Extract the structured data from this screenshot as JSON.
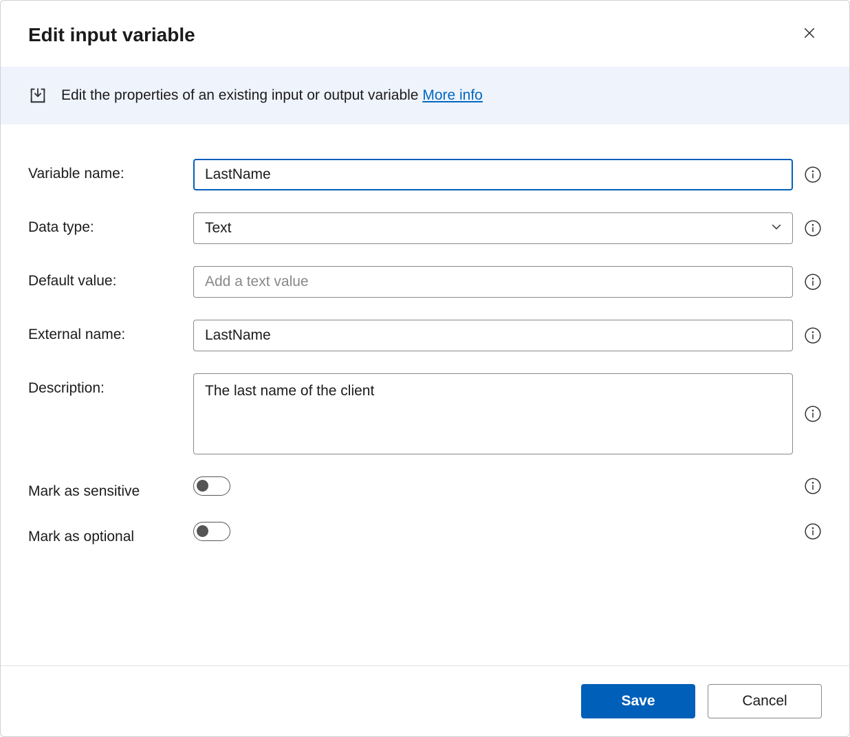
{
  "header": {
    "title": "Edit input variable"
  },
  "banner": {
    "text": "Edit the properties of an existing input or output variable ",
    "link_label": "More info"
  },
  "form": {
    "variable_name": {
      "label": "Variable name:",
      "value": "LastName"
    },
    "data_type": {
      "label": "Data type:",
      "value": "Text"
    },
    "default_value": {
      "label": "Default value:",
      "value": "",
      "placeholder": "Add a text value"
    },
    "external_name": {
      "label": "External name:",
      "value": "LastName"
    },
    "description": {
      "label": "Description:",
      "value": "The last name of the client"
    },
    "mark_sensitive": {
      "label": "Mark as sensitive",
      "value": false
    },
    "mark_optional": {
      "label": "Mark as optional",
      "value": false
    }
  },
  "footer": {
    "save_label": "Save",
    "cancel_label": "Cancel"
  }
}
